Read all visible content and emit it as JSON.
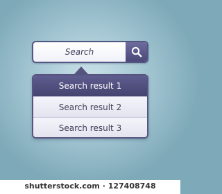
{
  "search": {
    "value": "Search",
    "button_icon": "magnifier-icon"
  },
  "results": {
    "items": [
      {
        "label": "Search result 1",
        "active": true
      },
      {
        "label": "Search result 2",
        "active": false
      },
      {
        "label": "Search result 3",
        "active": false
      }
    ]
  },
  "footer": {
    "watermark": "shutterstock.com · 127408748"
  },
  "colors": {
    "accent": "#4f4d7f",
    "background": "#a9cad6"
  }
}
